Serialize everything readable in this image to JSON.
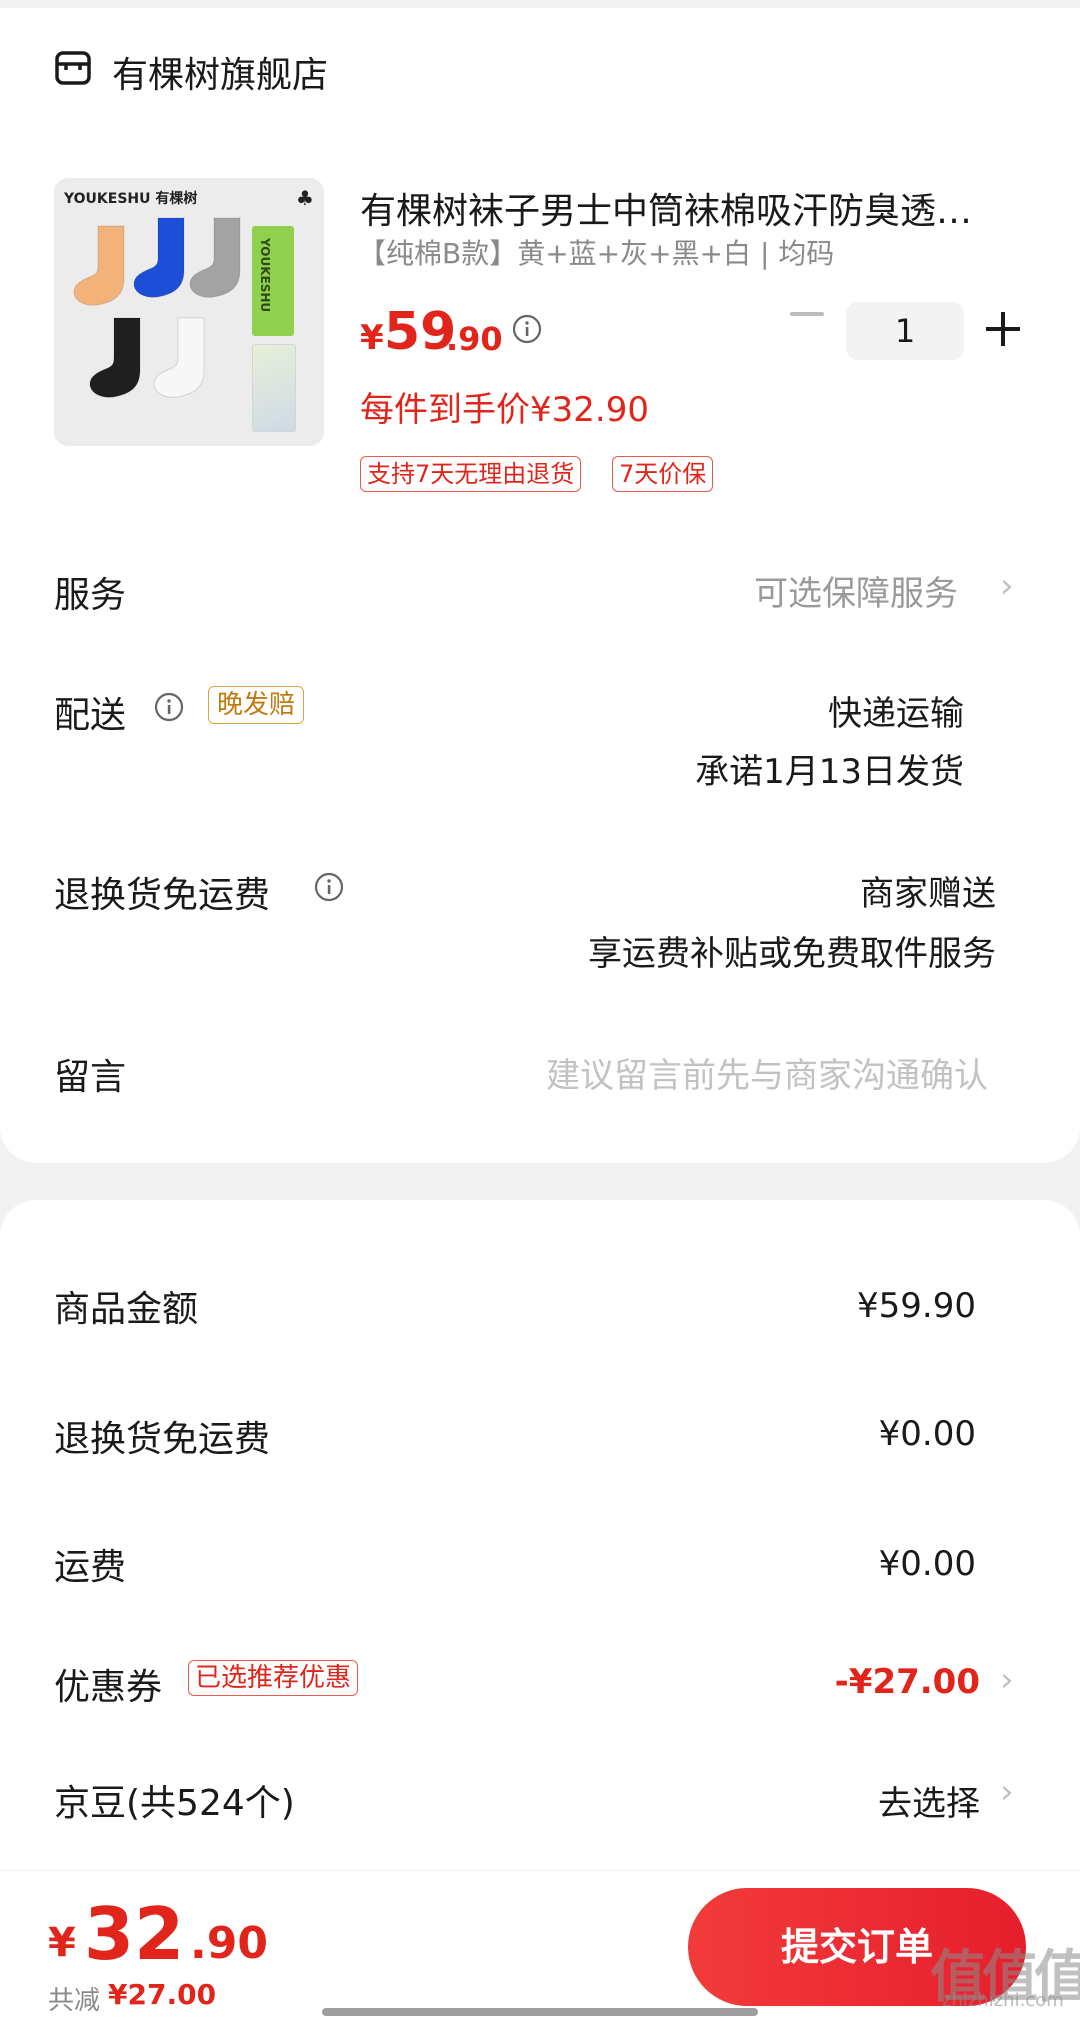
{
  "store": {
    "name": "有棵树旗舰店",
    "icon": "store-icon"
  },
  "product": {
    "brand_text": "YOUKESHU 有棵树",
    "brand_vertical": "YOUKESHU",
    "title": "有棵树袜子男士中筒袜棉吸汗防臭透…",
    "spec": "【纯棉B款】黄+蓝+灰+黑+白 | 均码",
    "price_symbol": "¥",
    "price_int": "59",
    "price_dec": ".90",
    "unit_price": "每件到手价¥32.90",
    "quantity": "1",
    "tags": [
      "支持7天无理由退货",
      "7天价保"
    ],
    "sock_colors": [
      "#f3b27a",
      "#1d4ed8",
      "#a3a3a3",
      "#1f1f1f",
      "#f7f7f7"
    ]
  },
  "rows": {
    "service": {
      "label": "服务",
      "value": "可选保障服务"
    },
    "delivery": {
      "label": "配送",
      "badge": "晚发赔",
      "value1": "快递运输",
      "value2": "承诺1月13日发货"
    },
    "return_shipping": {
      "label": "退换货免运费",
      "value1": "商家赠送",
      "value2": "享运费补贴或免费取件服务"
    },
    "message": {
      "label": "留言",
      "placeholder": "建议留言前先与商家沟通确认"
    }
  },
  "summary": {
    "goods_label": "商品金额",
    "goods_value": "¥59.90",
    "return_label": "退换货免运费",
    "return_value": "¥0.00",
    "freight_label": "运费",
    "freight_value": "¥0.00",
    "coupon_label": "优惠券",
    "coupon_badge": "已选推荐优惠",
    "coupon_value": "-¥27.00",
    "jingdou_label": "京豆(共524个)",
    "jingdou_value": "去选择"
  },
  "footer": {
    "total_symbol": "¥",
    "total_int": "32",
    "total_dec": ".90",
    "saved_label": "共减",
    "saved_value": "¥27.00",
    "submit_label": "提交订单",
    "watermark": "值值值",
    "watermark_sub": "zhizhizhi.com"
  },
  "colors": {
    "accent": "#e1251b",
    "badge_orange": "#c07a10"
  }
}
